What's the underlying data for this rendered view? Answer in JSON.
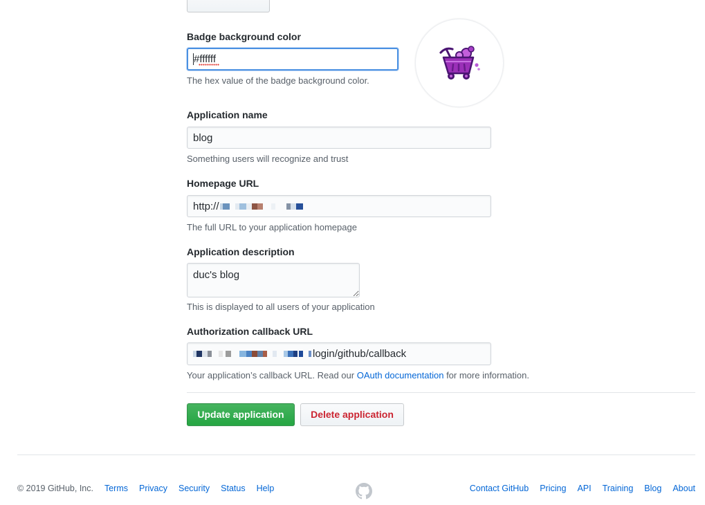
{
  "form": {
    "badge_color": {
      "label": "Badge background color",
      "value": "#ffffff",
      "help": "The hex value of the badge background color."
    },
    "application_name": {
      "label": "Application name",
      "value": "blog",
      "help": "Something users will recognize and trust"
    },
    "homepage_url": {
      "label": "Homepage URL",
      "value_prefix": "http://",
      "help": "The full URL to your application homepage"
    },
    "description": {
      "label": "Application description",
      "value": "duc's blog",
      "help": "This is displayed to all users of your application"
    },
    "callback_url": {
      "label": "Authorization callback URL",
      "value_suffix": "login/github/callback",
      "help_prefix": "Your application’s callback URL. Read our ",
      "help_link": "OAuth documentation",
      "help_suffix": " for more information."
    }
  },
  "badge_preview": {
    "icon": "minecart-icon"
  },
  "actions": {
    "update_label": "Update application",
    "delete_label": "Delete application"
  },
  "footer": {
    "copyright": "© 2019 GitHub, Inc.",
    "left_links": [
      "Terms",
      "Privacy",
      "Security",
      "Status",
      "Help"
    ],
    "center_icon": "octocat-icon",
    "right_links": [
      "Contact GitHub",
      "Pricing",
      "API",
      "Training",
      "Blog",
      "About"
    ]
  },
  "colors": {
    "primary_button": "#28a745",
    "danger_text": "#cb2431",
    "link": "#0366d6",
    "focus_border": "#4a90e2",
    "badge_icon": "#9b30b8"
  }
}
